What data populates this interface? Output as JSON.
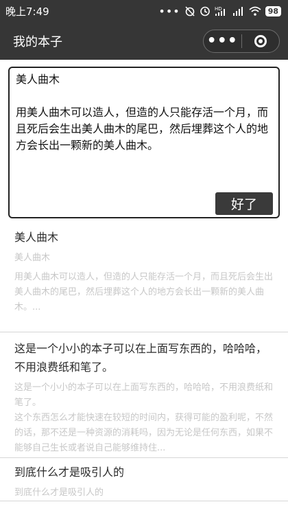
{
  "status_bar": {
    "time": "晚上7:49",
    "battery": "98",
    "icons": [
      "more-dots-icon",
      "alarm-off-icon",
      "clock-icon",
      "hd-signal-icon",
      "signal-icon",
      "wifi-icon",
      "battery-icon"
    ]
  },
  "navbar": {
    "title": "我的本子",
    "more_icon": "more-dots-icon",
    "close_icon": "target-icon"
  },
  "editor": {
    "content": "美人曲木\n\n用美人曲木可以造人，但造的人只能存活一个月，而且死后会生出美人曲木的尾巴，然后埋葬这个人的地方会长出一颗新的美人曲木。\n\n\n----",
    "ok_label": "好了"
  },
  "notes": [
    {
      "title": "美人曲木",
      "subtitle": "美人曲木",
      "body": "用美人曲木可以造人，但造的人只能存活一个月，而且死后会生出美人曲木的尾巴，然后埋葬这个人的地方会长出一颗新的美人曲木。..."
    },
    {
      "title": "这是一个小小的本子可以在上面写东西的，哈哈哈，不用浪费纸和笔了。",
      "subtitle": "",
      "body": "这是一个小小的本子可以在上面写东西的，哈哈哈，不用浪费纸和笔了。\n这个东西怎么才能快速在较短的时间内，获得可能的盈利呢，不然的话，那不还是一种资源的消耗吗，因为无论是任何东西，如果不能够自己生长或者说自己能够维持住..."
    },
    {
      "title": "到底什么才是吸引人的",
      "subtitle": "到底什么才是吸引人的",
      "body": ""
    }
  ],
  "colors": {
    "topbar": "#363636",
    "muted_text": "#c7c7c7",
    "button": "#3a3a3a"
  }
}
